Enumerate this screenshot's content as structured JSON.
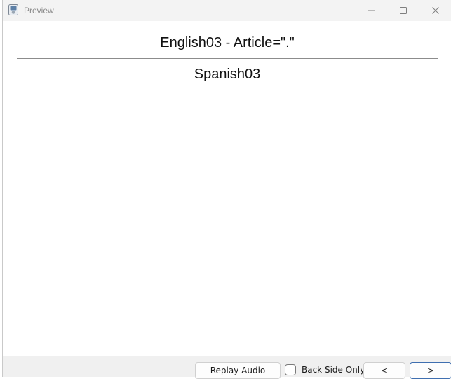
{
  "window": {
    "title": "Preview",
    "icon": "app-icon"
  },
  "card": {
    "front": "English03 - Article=\".\"",
    "back": "Spanish03"
  },
  "controls": {
    "replay_label": "Replay Audio",
    "back_side_only_label": "Back Side Only",
    "back_side_only_checked": false,
    "prev_label": "<",
    "next_label": ">"
  },
  "colors": {
    "titlebar_bg": "#f3f3f3",
    "bottombar_bg": "#f0f0f0",
    "focus_border": "#3f6fb0"
  }
}
